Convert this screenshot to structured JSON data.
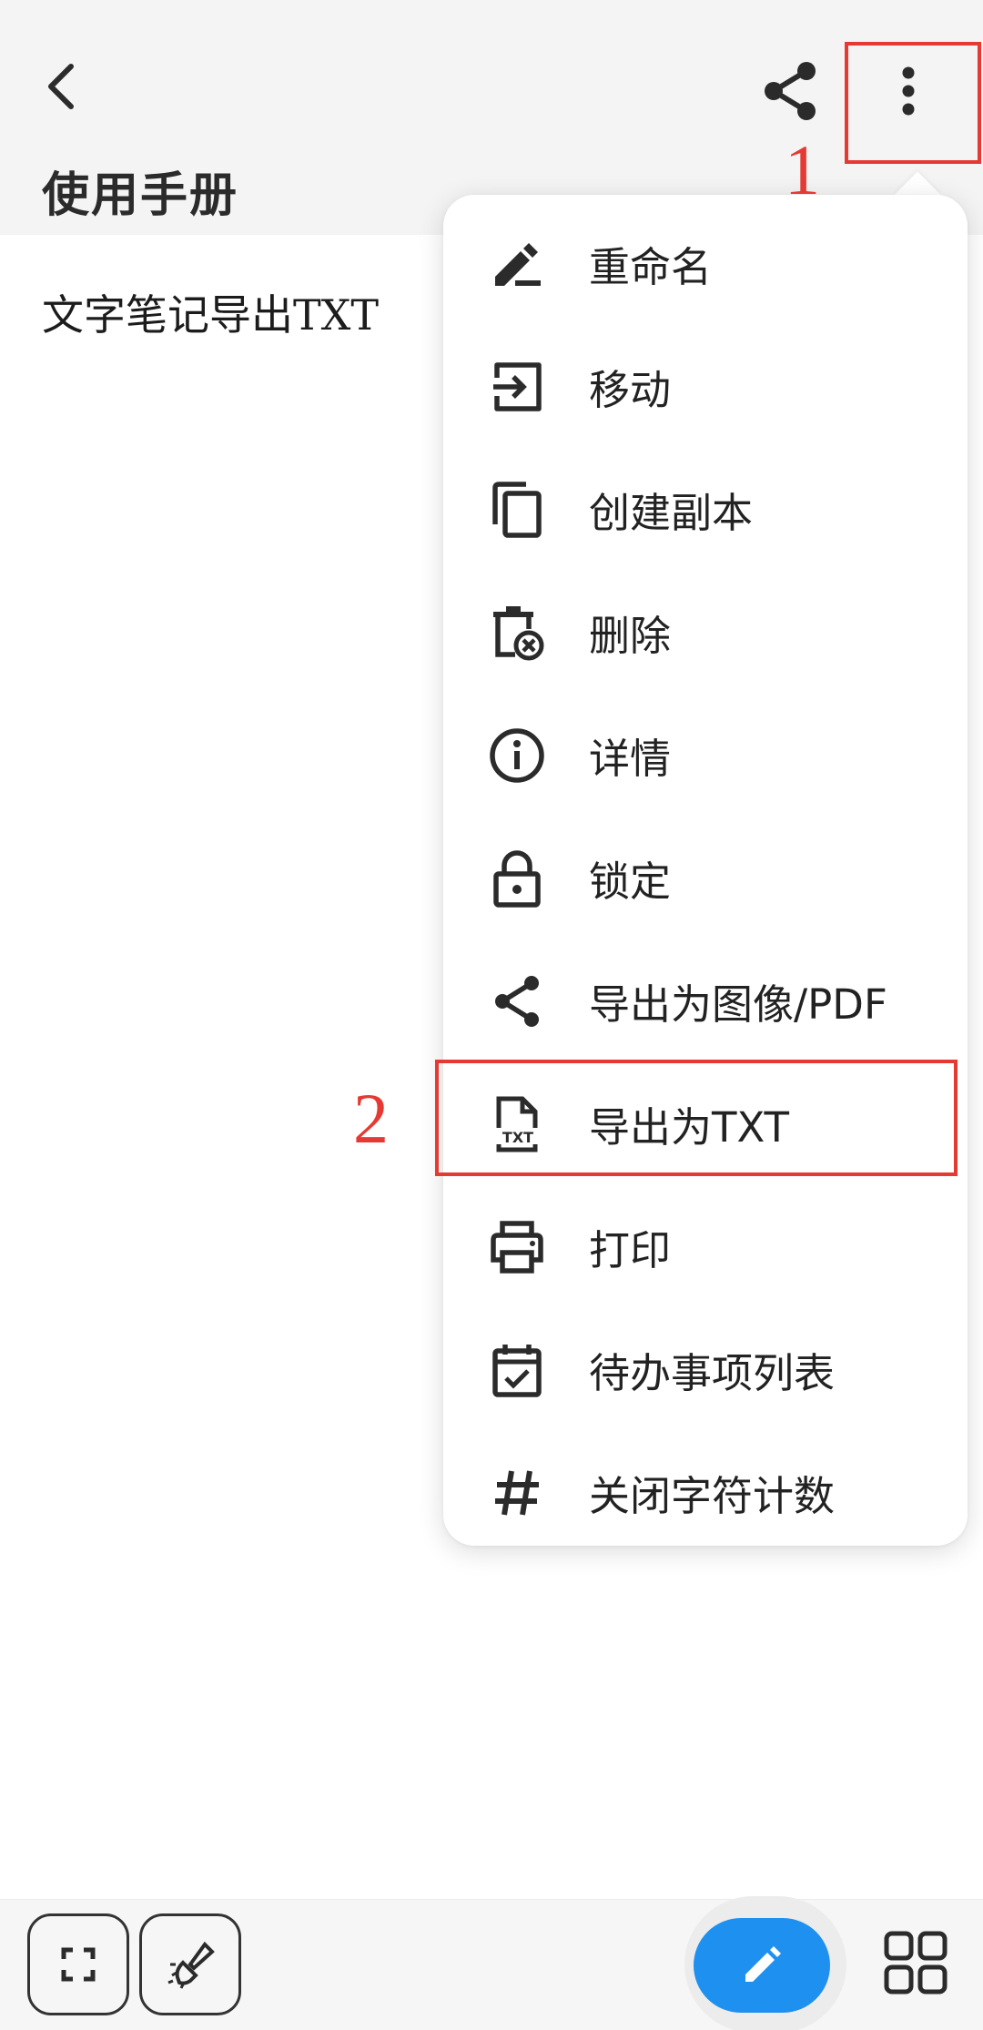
{
  "header": {
    "title": "使用手册",
    "icons": {
      "back": "back-arrow-icon",
      "share": "share-icon",
      "more": "more-vert-icon"
    }
  },
  "note": {
    "content": "文字笔记导出TXT"
  },
  "annotations": {
    "step1": "1",
    "step2": "2",
    "color": "#e53a33"
  },
  "menu": {
    "items": [
      {
        "label": "重命名",
        "icon": "rename-icon"
      },
      {
        "label": "移动",
        "icon": "move-icon"
      },
      {
        "label": "创建副本",
        "icon": "copy-icon"
      },
      {
        "label": "删除",
        "icon": "delete-icon"
      },
      {
        "label": "详情",
        "icon": "info-icon"
      },
      {
        "label": "锁定",
        "icon": "lock-icon"
      },
      {
        "label": "导出为图像/PDF",
        "icon": "share-icon"
      },
      {
        "label": "导出为TXT",
        "icon": "txt-file-icon"
      },
      {
        "label": "打印",
        "icon": "print-icon"
      },
      {
        "label": "待办事项列表",
        "icon": "todo-calendar-icon"
      },
      {
        "label": "关闭字符计数",
        "icon": "hash-icon"
      }
    ]
  },
  "bottom_bar": {
    "icons": {
      "fullscreen": "fullscreen-icon",
      "format": "magic-brush-icon",
      "edit": "pencil-icon",
      "grid": "grid-icon"
    },
    "accent": "#1e90f0"
  }
}
